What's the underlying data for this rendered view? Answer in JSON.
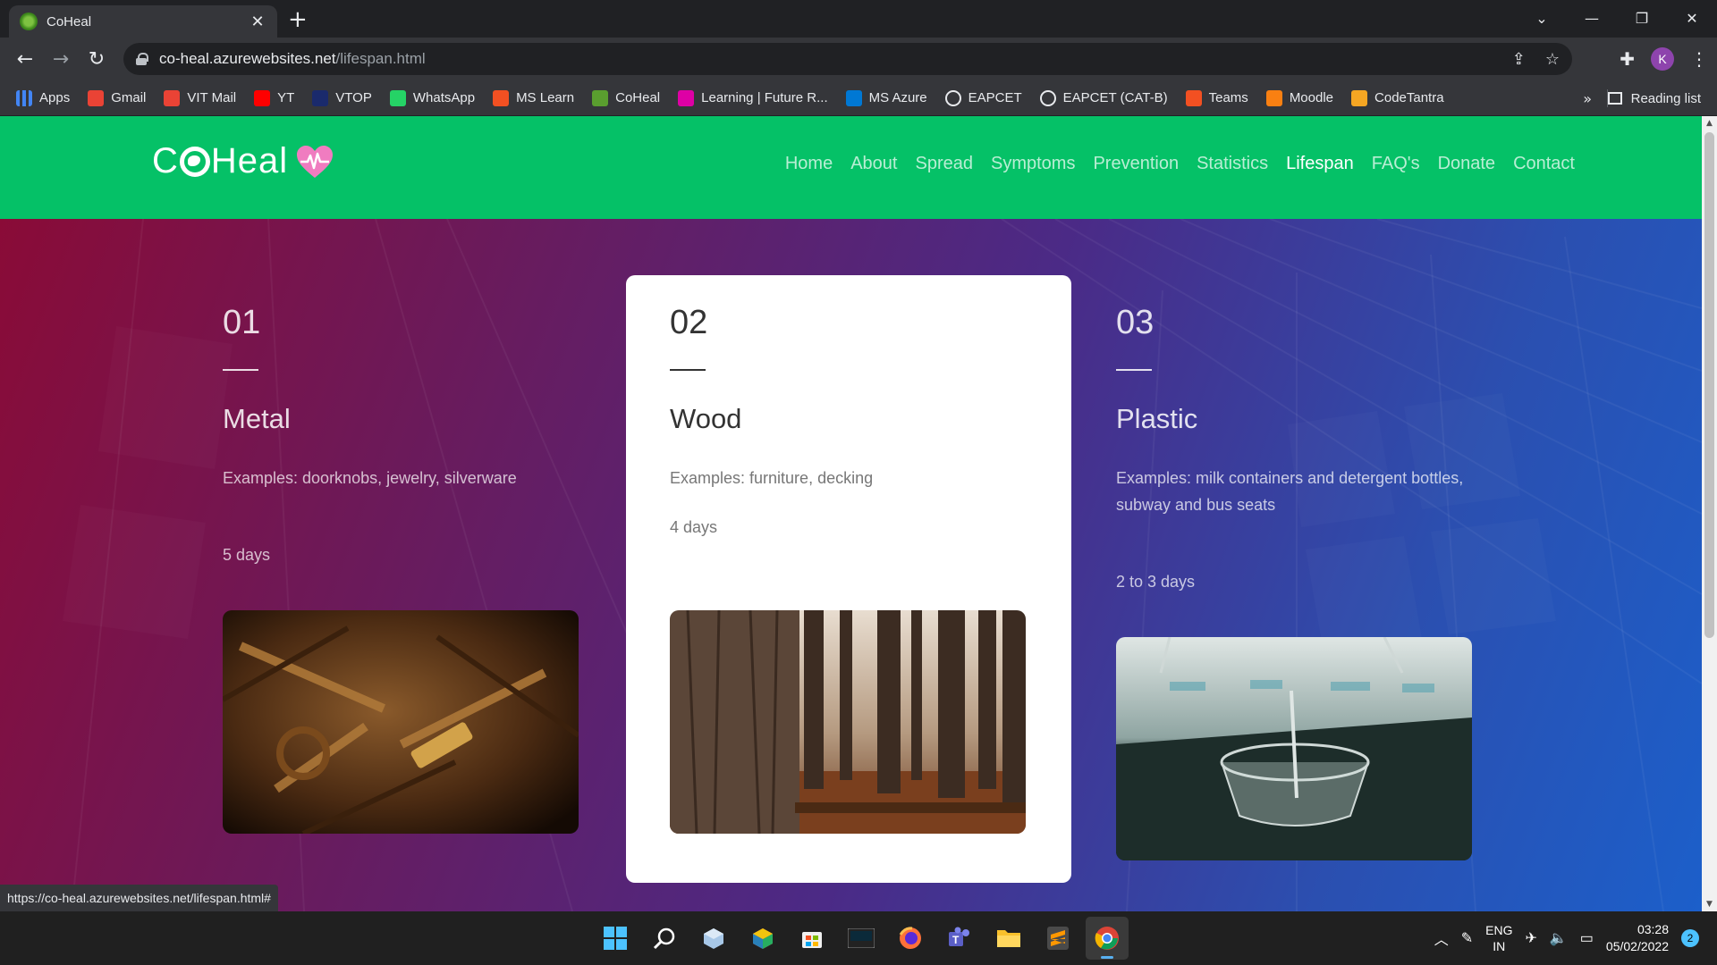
{
  "browser": {
    "tab_title": "CoHeal",
    "url_host": "co-heal.azurewebsites.net",
    "url_path": "/lifespan.html",
    "profile_initial": "K",
    "status_url": "https://co-heal.azurewebsites.net/lifespan.html#"
  },
  "bookmarks": [
    {
      "label": "Apps",
      "icon": "apps-grid-icon",
      "color": "#4285f4"
    },
    {
      "label": "Gmail",
      "icon": "gmail-icon",
      "color": "#ea4335"
    },
    {
      "label": "VIT Mail",
      "icon": "gmail-icon",
      "color": "#ea4335"
    },
    {
      "label": "YT",
      "icon": "youtube-icon",
      "color": "#ff0000"
    },
    {
      "label": "VTOP",
      "icon": "vtop-icon",
      "color": "#1a2a6c"
    },
    {
      "label": "WhatsApp",
      "icon": "whatsapp-icon",
      "color": "#25d366"
    },
    {
      "label": "MS Learn",
      "icon": "microsoft-icon",
      "color": "#f25022"
    },
    {
      "label": "CoHeal",
      "icon": "coheal-icon",
      "color": "#5a9e2f"
    },
    {
      "label": "Learning | Future R...",
      "icon": "futurelearn-icon",
      "color": "#de00a5"
    },
    {
      "label": "MS Azure",
      "icon": "azure-icon",
      "color": "#0078d4"
    },
    {
      "label": "EAPCET",
      "icon": "globe-icon",
      "color": "#e8eaed"
    },
    {
      "label": "EAPCET (CAT-B)",
      "icon": "globe-icon",
      "color": "#e8eaed"
    },
    {
      "label": "Teams",
      "icon": "microsoft-icon",
      "color": "#f25022"
    },
    {
      "label": "Moodle",
      "icon": "moodle-icon",
      "color": "#f98012"
    },
    {
      "label": "CodeTantra",
      "icon": "codetantra-icon",
      "color": "#f5a623"
    }
  ],
  "bookmarks_more": "»",
  "reading_list": "Reading list",
  "site": {
    "logo_left": "C",
    "logo_right": "Heal",
    "nav": [
      "Home",
      "About",
      "Spread",
      "Symptoms",
      "Prevention",
      "Statistics",
      "Lifespan",
      "FAQ's",
      "Donate",
      "Contact"
    ],
    "active_nav": "Lifespan",
    "brand_color": "#05c167"
  },
  "cards": [
    {
      "num": "01",
      "title": "Metal",
      "desc": "Examples: doorknobs, jewelry, silverware",
      "days": "5 days",
      "image": "rusty-tools-image"
    },
    {
      "num": "02",
      "title": "Wood",
      "desc": "Examples: furniture, decking",
      "days": "4 days",
      "image": "forest-trees-image"
    },
    {
      "num": "03",
      "title": "Plastic",
      "desc": "Examples: milk containers and detergent bottles, subway and bus seats",
      "days": "2 to 3 days",
      "image": "plastic-cup-image"
    }
  ],
  "taskbar": {
    "lang_top": "ENG",
    "lang_bottom": "IN",
    "time": "03:28",
    "date": "05/02/2022",
    "notifications": "2"
  }
}
